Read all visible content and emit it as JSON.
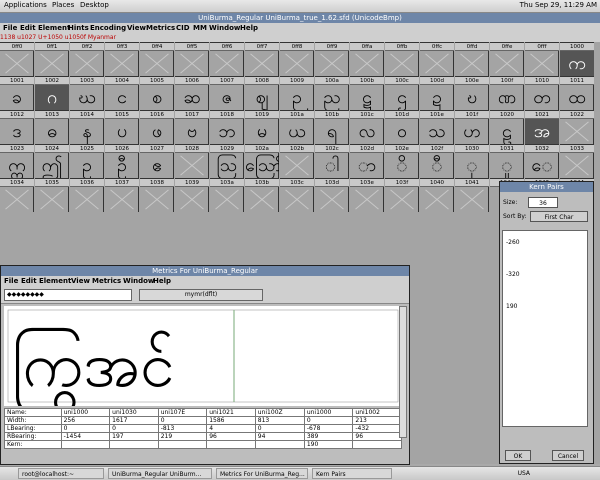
{
  "topbar": {
    "applications": "Applications",
    "places": "Places",
    "desktop": "Desktop",
    "clock": "Thu Sep 29, 11:29 AM"
  },
  "window": {
    "title": "UniBurma_Regular  UniBurma_true_1.62.sfd (UnicodeBmp)"
  },
  "menu": [
    "File",
    "Edit",
    "Element",
    "Hints",
    "Encoding",
    "View",
    "Metrics",
    "CID",
    "MM",
    "Window",
    "Help"
  ],
  "info": {
    "text": "1138   u1027  U+1050   u1050f  Myanmar"
  },
  "grid": {
    "labels": [
      "0ff0",
      "0ff1",
      "0ff2",
      "0ff3",
      "0ff4",
      "0ff5",
      "0ff6",
      "0ff7",
      "0ff8",
      "0ff9",
      "0ffa",
      "0ffb",
      "0ffc",
      "0ffd",
      "0ffe",
      "0fff",
      "1000",
      "1001",
      "1002",
      "1003",
      "1004",
      "1005",
      "1006",
      "1007",
      "1008",
      "1009",
      "100a",
      "100b",
      "100c",
      "100d",
      "100e",
      "100f",
      "1010",
      "1011",
      "1012",
      "1013",
      "1014",
      "1015",
      "1016",
      "1017",
      "1018",
      "1019",
      "101a",
      "101b",
      "101c",
      "101d",
      "101e",
      "101f",
      "1020",
      "1021",
      "1022",
      "1023",
      "1024",
      "1025",
      "1026",
      "1027",
      "1028",
      "1029",
      "102a",
      "102b",
      "102c",
      "102d",
      "102e",
      "102f",
      "1030",
      "1031",
      "1032",
      "1033",
      "1034",
      "1035",
      "1036",
      "1037",
      "1038",
      "1039",
      "103a",
      "103b",
      "103c",
      "103d",
      "103e",
      "103f",
      "1040",
      "1041",
      "1042",
      "1043",
      "1044"
    ],
    "glyphs": [
      "",
      "",
      "",
      "",
      "",
      "",
      "",
      "",
      "",
      "",
      "",
      "",
      "",
      "",
      "",
      "",
      "က",
      "ခ",
      "ဂ",
      "ဃ",
      "င",
      "စ",
      "ဆ",
      "ဇ",
      "ဈ",
      "ဉ",
      "ည",
      "ဋ",
      "ဌ",
      "ဍ",
      "ဎ",
      "ဏ",
      "တ",
      "ထ",
      "ဒ",
      "ဓ",
      "န",
      "ပ",
      "ဖ",
      "ဗ",
      "ဘ",
      "မ",
      "ယ",
      "ရ",
      "လ",
      "ဝ",
      "သ",
      "ဟ",
      "ဠ",
      "အ",
      "",
      "ဣ",
      "ဤ",
      "ဥ",
      "ဦ",
      "ဧ",
      "",
      "ဩ",
      "ဪ",
      "",
      "ါ",
      "ာ",
      "ိ",
      "ီ",
      "ု",
      "ူ",
      "ေ",
      "",
      "",
      "",
      "",
      "",
      "",
      "",
      "",
      "",
      "",
      "",
      "",
      "",
      "",
      "",
      "၀",
      "၁",
      ""
    ],
    "selected": [
      "1002",
      "1000",
      "1021"
    ]
  },
  "metrics": {
    "title": "Metrics For UniBurma_Regular",
    "menu": [
      "File",
      "Edit",
      "Element",
      "View",
      "Metrics",
      "Window",
      "Help"
    ],
    "text_field": "◆◆◆◆◆◆◆◆",
    "combo": "mymr(dflt)",
    "preview": "ကြွအင်",
    "table": [
      [
        "Name:",
        "uni1000",
        "uni1030",
        "uni107E",
        "uni1021",
        "uni100Z",
        "uni1000",
        "uni1002"
      ],
      [
        "Width:",
        "256",
        "1617",
        "0",
        "1586",
        "813",
        "0",
        "213"
      ],
      [
        "LBearing:",
        "0",
        "0",
        "-813",
        "4",
        "0",
        "-678",
        "-432"
      ],
      [
        "RBearing:",
        "-1454",
        "197",
        "219",
        "96",
        "94",
        "389",
        "96"
      ],
      [
        "Kern:",
        "",
        "",
        "",
        "",
        "",
        "190",
        ""
      ]
    ]
  },
  "kern": {
    "title": "Kern Pairs",
    "size_label": "Size:",
    "size_value": "36",
    "sort_label": "Sort By:",
    "sort_value": "First Char",
    "entries": [
      "-260",
      "-320",
      "190"
    ],
    "ok": "OK",
    "cancel": "Cancel"
  },
  "taskbar": {
    "items": [
      "root@localhost:~",
      "UniBurma_Regular  UniBurm...",
      "Metrics For UniBurma_Reg...",
      "Kern Pairs"
    ],
    "locale": "USA"
  }
}
